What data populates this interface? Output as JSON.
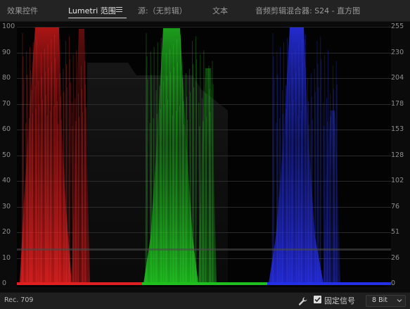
{
  "tabs": [
    {
      "label": "效果控件"
    },
    {
      "label": "Lumetri 范围"
    },
    {
      "label": "源:（无剪辑）"
    },
    {
      "label": "文本"
    },
    {
      "label": "音频剪辑混合器: S24 - 直方图"
    }
  ],
  "active_tab_index": 1,
  "scope": {
    "left_scale": [
      "100",
      "90",
      "80",
      "70",
      "60",
      "50",
      "40",
      "30",
      "20",
      "10",
      "0"
    ],
    "right_scale": [
      "255",
      "230",
      "204",
      "178",
      "153",
      "128",
      "102",
      "76",
      "51",
      "26",
      "0"
    ],
    "channel_colors": {
      "red": "#e02020",
      "green": "#1fbf1f",
      "blue": "#2430e8"
    }
  },
  "footer": {
    "color_space": "Rec. 709",
    "clamp_label": "固定信号",
    "clamp_checked": true,
    "bit_depth": "8 Bit"
  }
}
